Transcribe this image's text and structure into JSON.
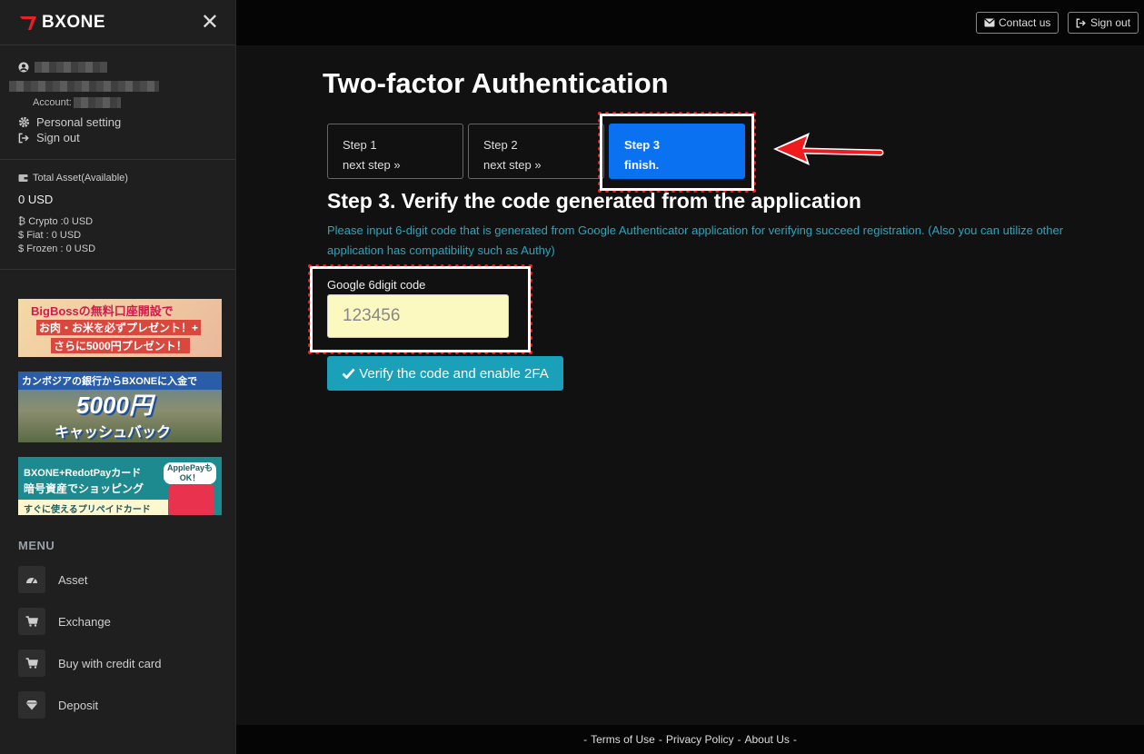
{
  "brand": {
    "name": "BXONE"
  },
  "sidebar": {
    "account_label": "Account:",
    "personal_setting": "Personal setting",
    "sign_out": "Sign out",
    "assets": {
      "title": "Total Asset(Available)",
      "total": "0 USD",
      "crypto_label": "Crypto :",
      "crypto_value": "0 USD",
      "fiat_label": "Fiat :",
      "fiat_value": "0 USD",
      "frozen_label": "Frozen :",
      "frozen_value": "0 USD"
    },
    "banners": [
      {
        "line1": "BigBossの無料口座開設で",
        "line2": "お肉・お米を必ずプレゼント！+",
        "line3": "さらに5000円プレゼント！"
      },
      {
        "line1": "カンボジアの銀行からBXONEに入金で",
        "line2": "5000円",
        "line3": "キャッシュバック"
      },
      {
        "line1": "BXONE+RedotPayカード",
        "line2": "暗号資産でショッピング",
        "line3": "すぐに使えるプリペイドカード",
        "badge": "ApplePayも OK！"
      }
    ],
    "menu_title": "MENU",
    "menu": [
      {
        "label": "Asset",
        "icon": "dashboard-icon"
      },
      {
        "label": "Exchange",
        "icon": "cart-icon"
      },
      {
        "label": "Buy with credit card",
        "icon": "cart-icon"
      },
      {
        "label": "Deposit",
        "icon": "diamond-icon"
      }
    ]
  },
  "topbar": {
    "contact": "Contact us",
    "signout": "Sign out"
  },
  "main": {
    "title": "Two-factor Authentication",
    "steps": [
      {
        "title": "Step 1",
        "sub": "next step »"
      },
      {
        "title": "Step 2",
        "sub": "next step »"
      },
      {
        "title": "Step 3",
        "sub": "finish."
      }
    ],
    "heading": "Step 3. Verify the code generated from the application",
    "description": "Please input 6-digit code that is generated from Google Authenticator application for verifying succeed registration. (Also you can utilize other application has compatibility such as Authy)",
    "field_label": "Google 6digit code",
    "field_placeholder": "123456",
    "verify_button": "Verify the code and enable 2FA"
  },
  "footer": {
    "terms": "Terms of Use",
    "privacy": "Privacy Policy",
    "about": "About Us"
  },
  "colors": {
    "accent_blue": "#0a72f0",
    "teal": "#1aa0b8",
    "annotation_red": "#ff1a1a"
  }
}
